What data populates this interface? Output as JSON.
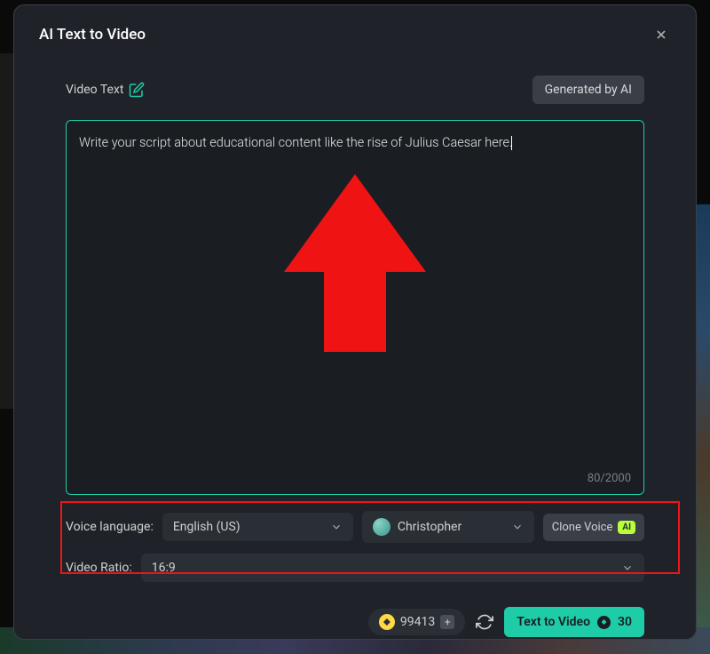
{
  "modal": {
    "title": "AI Text to Video",
    "video_text_label": "Video Text",
    "generated_by_ai_label": "Generated by AI",
    "script_text": "Write your script about educational content like the rise of Julius Caesar here.",
    "char_count": "80/2000"
  },
  "voice": {
    "label": "Voice language:",
    "language": "English (US)",
    "voice_name": "Christopher",
    "clone_label": "Clone Voice",
    "ai_badge": "AI"
  },
  "ratio": {
    "label": "Video Ratio:",
    "value": "16:9"
  },
  "footer": {
    "credits": "99413",
    "t2v_label": "Text to Video",
    "t2v_cost": "30"
  }
}
